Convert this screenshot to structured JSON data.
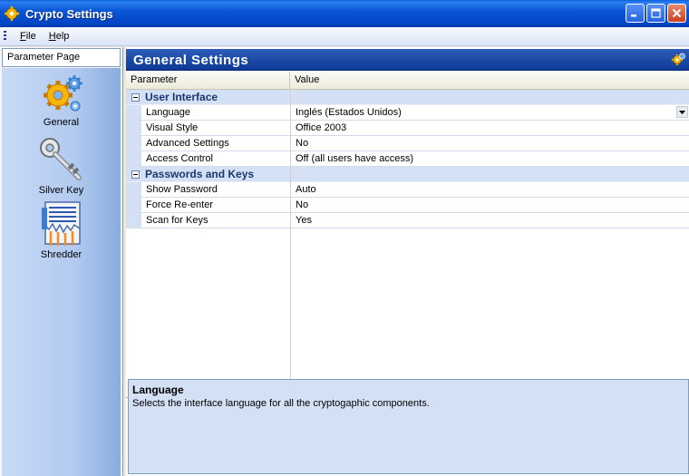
{
  "window": {
    "title": "Crypto Settings",
    "app_icon": "gear-icon"
  },
  "menubar": {
    "items": [
      {
        "label": "File",
        "accel": "F",
        "rest": "ile"
      },
      {
        "label": "Help",
        "accel": "H",
        "rest": "elp"
      }
    ]
  },
  "sidebar": {
    "header": "Parameter Page",
    "items": [
      {
        "label": "General",
        "icon": "gears-icon"
      },
      {
        "label": "Silver Key",
        "icon": "key-icon"
      },
      {
        "label": "Shredder",
        "icon": "shredder-icon"
      }
    ]
  },
  "main": {
    "title": "General Settings",
    "columns": {
      "parameter": "Parameter",
      "value": "Value"
    },
    "categories": [
      {
        "label": "User Interface",
        "properties": [
          {
            "name": "Language",
            "value": "Inglés (Estados Unidos)",
            "has_dropdown": true
          },
          {
            "name": "Visual Style",
            "value": "Office 2003"
          },
          {
            "name": "Advanced Settings",
            "value": "No"
          },
          {
            "name": "Access Control",
            "value": "Off (all users have access)"
          }
        ]
      },
      {
        "label": "Passwords and Keys",
        "properties": [
          {
            "name": "Show Password",
            "value": "Auto"
          },
          {
            "name": "Force Re-enter",
            "value": "No"
          },
          {
            "name": "Scan for Keys",
            "value": "Yes"
          }
        ]
      }
    ],
    "description": {
      "title": "Language",
      "text": "Selects the interface language for all the cryptogaphic components."
    }
  },
  "colors": {
    "titlebar": "#0a55d6",
    "category_bg": "#d4e0f4",
    "header_blue": "#1c4aa8"
  }
}
